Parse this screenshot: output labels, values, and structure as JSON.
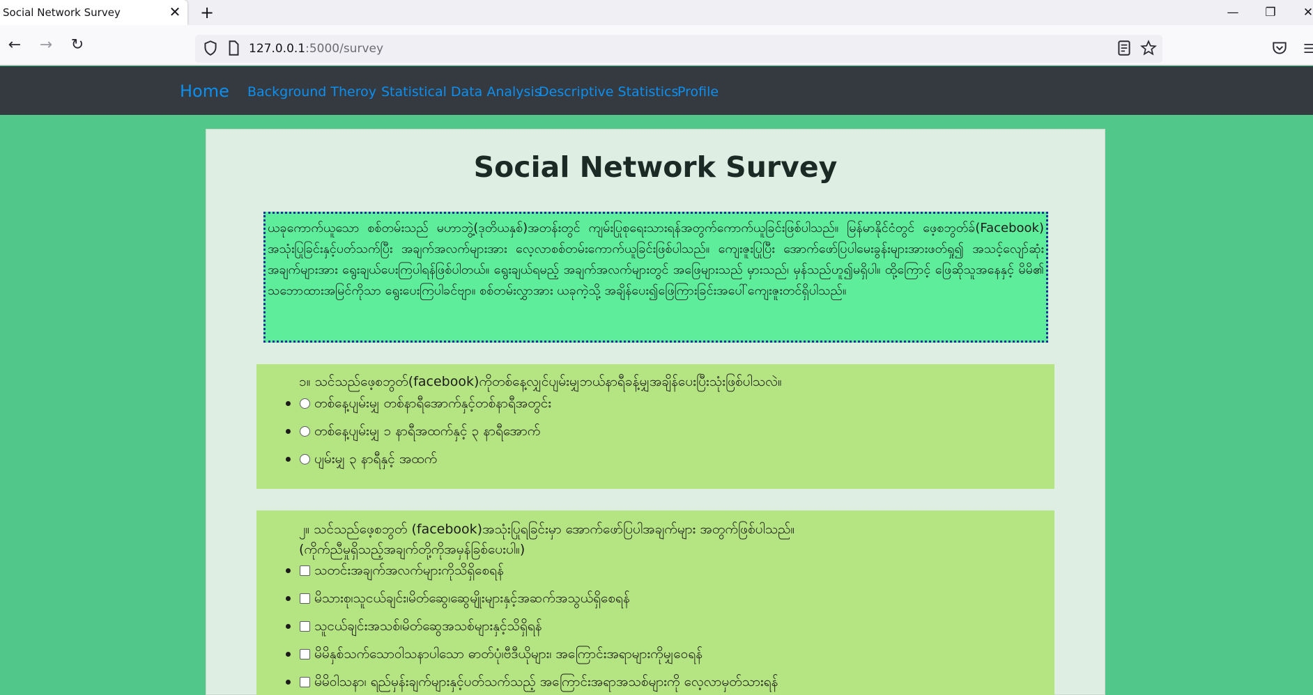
{
  "browser": {
    "tab_title": "Social Network Survey",
    "tab_close_glyph": "✕",
    "new_tab_glyph": "+",
    "url_host": "127.0.0.1",
    "url_rest": ":5000/survey"
  },
  "site_nav": {
    "brand": "Home",
    "links": [
      "Background Theroy",
      "Statistical Data Analysis",
      "Descriptive Statistics",
      "Profile"
    ]
  },
  "page": {
    "title": "Social Network Survey",
    "intro": "ယခုကောက်ယူသော စစ်တမ်းသည် မဟာဘွဲ့(ဒုတိယနှစ်)အတန်းတွင် ကျမ်းပြုစုရေးသားရန်အတွက်ကောက်ယူခြင်းဖြစ်ပါသည်။ မြန်မာနိုင်ငံတွင် ဖေ့စဘွတ်ခ်(Facebook) အသုံးပြုခြင်းနှင့်ပတ်သက်ပြီး အချက်အလက်များအား လေ့လာစစ်တမ်းကောက်ယူခြင်းဖြစ်ပါသည်။ ကျေးဇူးပြုပြီး အောက်ဖော်ပြပါမေးခွန်းများအားဖတ်ရှု၍ အသင့်လျော်ဆုံးအချက်များအား ရွေးချယ်ပေးကြပါရန်ဖြစ်ပါတယ်။ ရွေးချယ်ရမည့် အချက်အလက်များတွင် အဖြေများသည် မှားသည်၊ မှန်သည်ဟူ၍မရှိပါ။ ထို့ကြောင့် ဖြေဆိုသူအနေနှင့် မိမိ၏ သဘောထားအမြင်ကိုသာ ရွေးပေးကြပါခင်ဗျာ။ စစ်တမ်းလွှာအား ယခုကဲ့သို့ အချိန်ပေး၍ဖြေကြားခြင်းအပေါ်ကျေးဇူးတင်ရှိပါသည်။"
  },
  "q1": {
    "text": "၁။ သင်သည်ဖေ့စဘွတ်(facebook)ကိုတစ်နေ့လျှင်ပျမ်းမျှဘယ်နာရီခန့်မျှအချိန်ပေးပြီးသုံးဖြစ်ပါသလဲ။",
    "options": [
      "တစ်နေ့ပျမ်းမျှ တစ်နာရီအောက်နှင့်တစ်နာရီအတွင်း",
      "တစ်နေ့ပျမ်းမျှ ၁ နာရီအထက်နှင့် ၃ နာရီအောက်",
      "ပျမ်းမျှ ၃ နာရီနှင့် အထက်"
    ]
  },
  "q2": {
    "text_line1": "၂။ သင်သည်ဖေ့စဘွတ် (facebook)အသုံးပြုရခြင်းမှာ အောက်ဖော်ပြပါအချက်များ အတွက်ဖြစ်ပါသည်။",
    "text_line2": "(ကိုက်ညီမှုရှိသည့်အချက်တို့ကိုအမှန်ခြစ်ပေးပါ။)",
    "options": [
      "သတင်းအချက်အလက်များကိုသိရှိစေရန်",
      "မိသားစု၊သူငယ်ချင်း၊မိတ်ဆွေ၊ဆွေမျိုးများနှင့်အဆက်အသွယ်ရှိစေရန်",
      "သူငယ်ချင်းအသစ်၊မိတ်ဆွေအသစ်များနှင့်သိရှိရန်",
      "မိမိနှစ်သက်သောဝါသနာပါသော ဓာတ်ပုံ၊ဗီဒီယိုများ၊ အကြောင်းအရာများကိုမျှဝေရန်",
      "မိမိဝါသနာ၊ ရည်မှန်းချက်များနှင့်ပတ်သက်သည့် အကြောင်းအရာအသစ်များကို လေ့လာမှတ်သားရန်"
    ]
  }
}
